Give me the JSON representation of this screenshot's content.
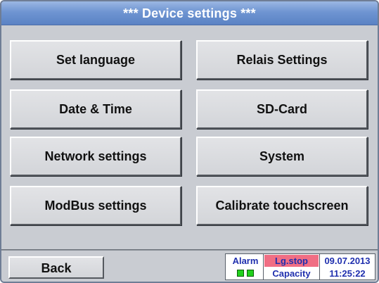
{
  "window": {
    "title": "***  Device settings  ***"
  },
  "menu": {
    "buttons": [
      {
        "label": "Set language"
      },
      {
        "label": "Relais Settings"
      },
      {
        "label": "Date & Time"
      },
      {
        "label": "SD-Card"
      },
      {
        "label": "Network settings"
      },
      {
        "label": "System"
      },
      {
        "label": "ModBus settings"
      },
      {
        "label": "Calibrate touchscreen"
      }
    ]
  },
  "footer": {
    "back_label": "Back",
    "status": {
      "alarm_label": "Alarm",
      "logging_label": "Lg.stop",
      "capacity_label": "Capacity",
      "date": "09.07.2013",
      "time": "11:25:22"
    }
  },
  "colors": {
    "title_bar": "#6f95d2",
    "background": "#c9ccd2",
    "button_face": "#d9dadd",
    "status_text": "#1f2fae",
    "logging_stop_highlight": "#f06e84",
    "alarm_led": "#22d11c"
  }
}
